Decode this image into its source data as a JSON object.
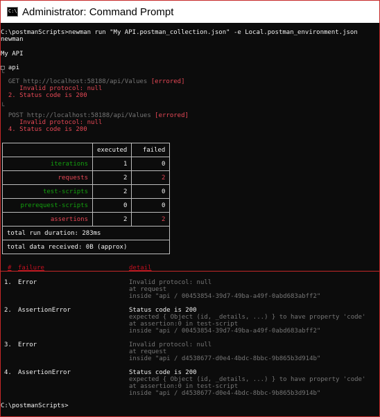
{
  "window": {
    "title": "Administrator: Command Prompt",
    "icon_text": "C:\\"
  },
  "console": {
    "command": "C:\\postmanScripts>newman run \"My API.postman_collection.json\" -e Local.postman_environment.json",
    "tool": "newman",
    "collection": "My API",
    "folder": "□ api",
    "bracket1": "└",
    "req1": {
      "method_url": "  GET http://localhost:58188/api/Values ",
      "status": "[errored]",
      "error": "     Invalid protocol: null",
      "assertion": "  2. Status code is 200"
    },
    "bracket2": "└",
    "req2": {
      "method_url": "  POST http://localhost:58188/api/Values ",
      "status": "[errored]",
      "error": "     Invalid protocol: null",
      "assertion": "  4. Status code is 200"
    }
  },
  "summary": {
    "headers": {
      "executed": "executed",
      "failed": "failed"
    },
    "rows": [
      {
        "label": "iterations",
        "executed": "1",
        "failed": "0"
      },
      {
        "label": "requests",
        "executed": "2",
        "failed": "2"
      },
      {
        "label": "test-scripts",
        "executed": "2",
        "failed": "0"
      },
      {
        "label": "prerequest-scripts",
        "executed": "0",
        "failed": "0"
      },
      {
        "label": "assertions",
        "executed": "2",
        "failed": "2"
      }
    ],
    "run_duration": "total run duration: 283ms",
    "data_received": "total data received: 0B (approx)"
  },
  "failures": {
    "col_num": "#",
    "col_failure": "failure",
    "col_detail": "detail",
    "items": [
      {
        "num": "1.",
        "type": "Error",
        "detail1": "Invalid protocol: null",
        "detail2": "at request",
        "detail3": "inside \"api / 00453854-39d7-49ba-a49f-0abd683abff2\""
      },
      {
        "num": "2.",
        "type": "AssertionError",
        "detail1": "Status code is 200",
        "detail2": "expected { Object (id, _details, ...) } to have property 'code'",
        "detail3": "at assertion:0 in test-script",
        "detail4": "inside \"api / 00453854-39d7-49ba-a49f-0abd683abff2\""
      },
      {
        "num": "3.",
        "type": "Error",
        "detail1": "Invalid protocol: null",
        "detail2": "at request",
        "detail3": "inside \"api / d4538677-d0e4-4bdc-8bbc-9b865b3d914b\""
      },
      {
        "num": "4.",
        "type": "AssertionError",
        "detail1": "Status code is 200",
        "detail2": "expected { Object (id, _details, ...) } to have property 'code'",
        "detail3": "at assertion:0 in test-script",
        "detail4": "inside \"api / d4538677-d0e4-4bdc-8bbc-9b865b3d914b\""
      }
    ]
  },
  "prompt": "C:\\postmanScripts>"
}
